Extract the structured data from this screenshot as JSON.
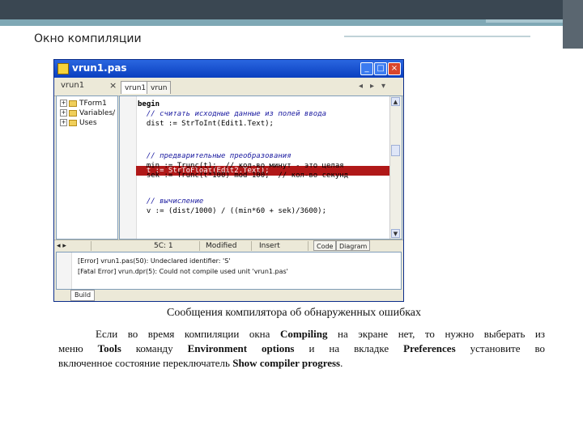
{
  "slide": {
    "title": "Окно компиляции",
    "caption": "Сообщения компилятора об обнаруженных ошибках",
    "paragraph": {
      "p1": "Если во время компиляции окна ",
      "b1": "Compiling",
      "p2": " на экране нет, то нужно выберать из",
      "p3": "меню ",
      "b2": "Tools",
      "p4": " команду ",
      "b3": "Environment options",
      "p5": " и на вкладке ",
      "b4": "Preferences",
      "p6": " установите во",
      "p7": "включенное состояние переключатель ",
      "b5": "Show compiler progress",
      "p8": "."
    }
  },
  "window": {
    "title": "vrun1.pas",
    "toolbar_title": "vrun1",
    "tabs": [
      "vrun1",
      "vrun"
    ],
    "tree": [
      "TForm1",
      "Variables/",
      "Uses"
    ],
    "code": [
      "begin",
      "  // считать исходные данные из полей ввода",
      "  dist := StrToInt(Edit1.Text);",
      "  t := StrToFloat(Edit2.Text);",
      "",
      "  // предварительные преобразования",
      "  min := Trunc(t);  // кол-во минут - это целая",
      "  sek := Trunc(t*100) mod 100;  // кол-во секунд",
      "",
      "  // вычисление",
      "  v := (dist/1000) / ((min*60 + sek)/3600);"
    ],
    "status": {
      "position": "5C: 1",
      "modified": "Modified",
      "mode": "Insert",
      "tab_code": "Code",
      "tab_diagram": "Diagram"
    },
    "messages": [
      "[Error] vrun1.pas(50): Undeclared identifier: 'S'",
      "[Fatal Error] vrun.dpr(5): Could not compile used unit 'vrun1.pas'"
    ],
    "build_tab": "Build"
  },
  "colors": {
    "titlebar": "#0a3fbf",
    "error_highlight": "#b01818",
    "slide_bar": "#3a4752",
    "slide_accent": "#7fa8b5"
  }
}
